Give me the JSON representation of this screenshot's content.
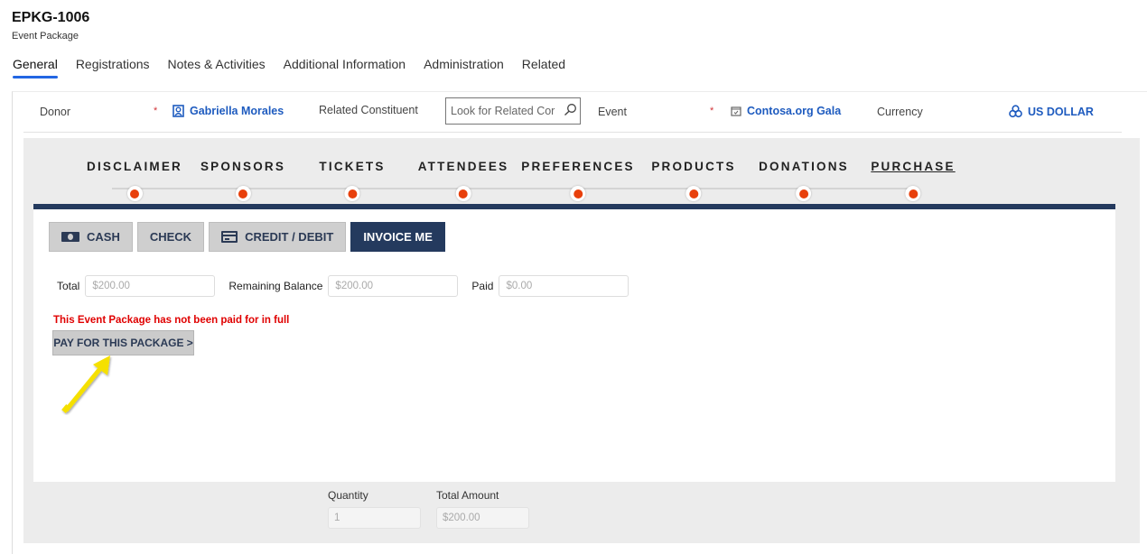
{
  "record": {
    "title": "EPKG-1006",
    "entity": "Event Package"
  },
  "tabs": [
    {
      "label": "General",
      "active": true
    },
    {
      "label": "Registrations",
      "active": false
    },
    {
      "label": "Notes & Activities",
      "active": false
    },
    {
      "label": "Additional Information",
      "active": false
    },
    {
      "label": "Administration",
      "active": false
    },
    {
      "label": "Related",
      "active": false
    }
  ],
  "header": {
    "donor_label": "Donor",
    "donor_required": "*",
    "donor_value": "Gabriella Morales",
    "donor_icon": "contact-icon",
    "related_label": "Related Constituent",
    "related_placeholder": "Look for Related Cor",
    "related_icon": "search-icon",
    "event_label": "Event",
    "event_required": "*",
    "event_value": "Contosa.org Gala",
    "event_icon": "calendar-icon",
    "currency_label": "Currency",
    "currency_value": "US DOLLAR",
    "currency_icon": "currency-icon"
  },
  "steps": [
    {
      "label": "DISCLAIMER"
    },
    {
      "label": "SPONSORS"
    },
    {
      "label": "TICKETS"
    },
    {
      "label": "ATTENDEES"
    },
    {
      "label": "PREFERENCES"
    },
    {
      "label": "PRODUCTS"
    },
    {
      "label": "DONATIONS"
    },
    {
      "label": "PURCHASE",
      "current": true
    }
  ],
  "payment_methods": [
    {
      "label": "CASH",
      "icon": "cash-icon"
    },
    {
      "label": "CHECK"
    },
    {
      "label": "CREDIT / DEBIT",
      "icon": "credit-card-icon"
    },
    {
      "label": "INVOICE ME",
      "active": true
    }
  ],
  "amounts": {
    "total_label": "Total",
    "total_value": "$200.00",
    "remaining_label": "Remaining Balance",
    "remaining_value": "$200.00",
    "paid_label": "Paid",
    "paid_value": "$0.00"
  },
  "warning": "This Event Package has not been paid for in full",
  "pay_button": "PAY FOR THIS PACKAGE >",
  "summary": {
    "quantity_label": "Quantity",
    "quantity_value": "1",
    "total_amount_label": "Total Amount",
    "total_amount_value": "$200.00"
  },
  "colors": {
    "accent": "#2266e3",
    "navy": "#243a5e",
    "step_dot": "#e8400c",
    "warning": "#e00000",
    "link": "#1e5bbf",
    "annotation_arrow": "#f5e000"
  }
}
